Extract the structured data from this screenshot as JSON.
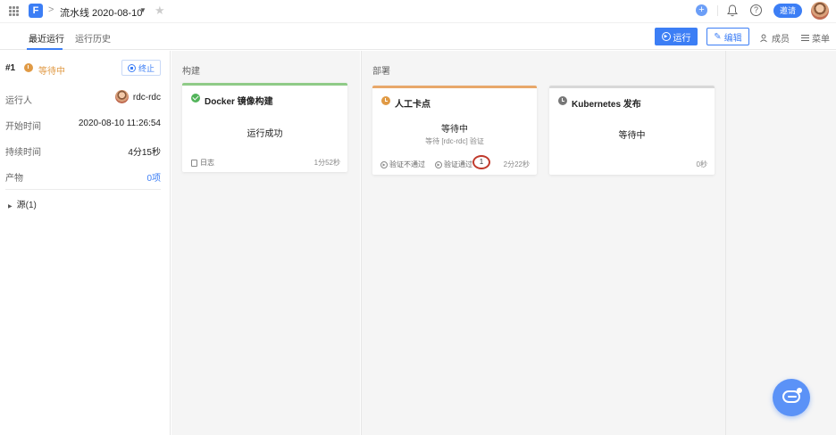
{
  "header": {
    "logo_letter": "F",
    "breadcrumb_sep": ">",
    "pipeline_title": "流水线 2020-08-10",
    "invite_label": "邀请",
    "plus_label": "+",
    "help_label": "?"
  },
  "tabs": {
    "recent": "最近运行",
    "history": "运行历史"
  },
  "actions": {
    "run": "运行",
    "edit": "编辑",
    "members": "成员",
    "menu": "菜单"
  },
  "run": {
    "number": "#1",
    "status": "等待中",
    "stop_label": "终止",
    "runner_label": "运行人",
    "runner_value": "rdc-rdc",
    "start_label": "开始时间",
    "start_value": "2020-08-10 11:26:54",
    "duration_label": "持续时间",
    "duration_value": "4分15秒",
    "artifacts_label": "产物",
    "artifacts_value": "0项",
    "source_label": "源(1)"
  },
  "stages": {
    "build": {
      "title": "构建",
      "job": {
        "name": "Docker 镜像构建",
        "status": "运行成功",
        "log_label": "日志",
        "duration": "1分52秒",
        "accent": "#8fcb87"
      }
    },
    "deploy": {
      "title": "部署",
      "jobs": [
        {
          "name": "人工卡点",
          "status": "等待中",
          "sub": "等待 [rdc-rdc] 验证",
          "reject_label": "验证不通过",
          "approve_label": "验证通过",
          "badge": "1",
          "duration": "2分22秒",
          "accent": "#e8a86a"
        },
        {
          "name": "Kubernetes 发布",
          "status": "等待中",
          "duration": "0秒",
          "accent": "#d8d8d8"
        }
      ]
    }
  },
  "icons": {
    "apps": "grid-icon",
    "star": "star-icon",
    "bell": "bell-icon",
    "help": "help-icon",
    "chat": "chat-icon"
  },
  "colors": {
    "primary": "#3c7ef5",
    "success": "#52b45a",
    "waiting": "#e09a45",
    "badge_ring": "#c0392b"
  }
}
